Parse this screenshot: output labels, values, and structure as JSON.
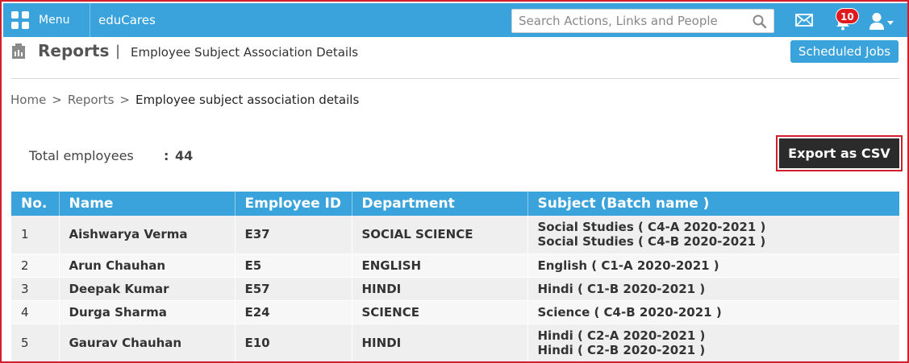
{
  "nav": {
    "menu_label": "Menu",
    "brand": "eduCares",
    "search_placeholder": "Search Actions, Links and People",
    "notification_count": "10",
    "icons": [
      "grid-icon",
      "search-icon",
      "mail-icon",
      "bell-icon",
      "user-icon",
      "caret-down-icon"
    ]
  },
  "header": {
    "title": "Reports",
    "separator": "|",
    "subtitle": "Employee Subject Association Details",
    "scheduled_jobs_label": "Scheduled Jobs"
  },
  "breadcrumb": {
    "items": [
      "Home",
      "Reports"
    ],
    "current": "Employee subject association details",
    "separator": ">"
  },
  "summary": {
    "total_label": "Total employees",
    "colon": ":",
    "total_value": "44",
    "export_label": "Export as CSV"
  },
  "table": {
    "columns": [
      "No.",
      "Name",
      "Employee ID",
      "Department",
      "Subject (Batch name )"
    ],
    "rows": [
      {
        "no": "1",
        "name": "Aishwarya Verma",
        "employee_id": "E37",
        "department": "SOCIAL SCIENCE",
        "subjects": [
          "Social Studies ( C4-A 2020-2021 )",
          "Social Studies ( C4-B 2020-2021 )"
        ]
      },
      {
        "no": "2",
        "name": "Arun Chauhan",
        "employee_id": "E5",
        "department": "ENGLISH",
        "subjects": [
          "English ( C1-A 2020-2021 )"
        ]
      },
      {
        "no": "3",
        "name": "Deepak Kumar",
        "employee_id": "E57",
        "department": "HINDI",
        "subjects": [
          "Hindi ( C1-B 2020-2021 )"
        ]
      },
      {
        "no": "4",
        "name": "Durga Sharma",
        "employee_id": "E24",
        "department": "SCIENCE",
        "subjects": [
          "Science ( C4-B 2020-2021 )"
        ]
      },
      {
        "no": "5",
        "name": "Gaurav Chauhan",
        "employee_id": "E10",
        "department": "HINDI",
        "subjects": [
          "Hindi ( C2-A 2020-2021 )",
          "Hindi ( C2-B 2020-2021 )"
        ]
      }
    ]
  },
  "colors": {
    "primary": "#3ba3db",
    "highlight_border": "#d21f2b",
    "badge": "#e0191e",
    "export_button": "#2b2b2b",
    "row_odd": "#efefef",
    "row_even": "#f7f7f7"
  }
}
